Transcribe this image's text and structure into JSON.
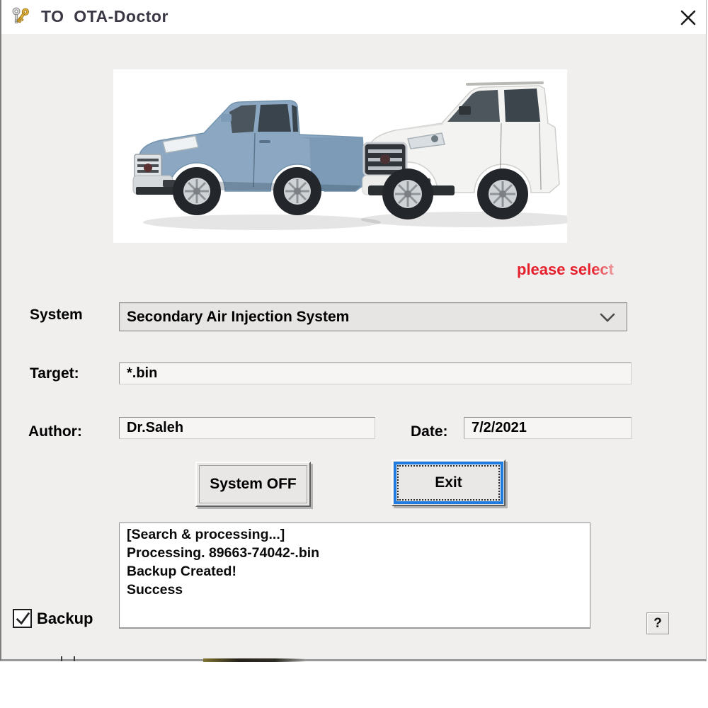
{
  "window": {
    "title": "TO  OTA-Doctor",
    "title_icon": "keys-icon",
    "close_icon": "close-icon"
  },
  "banner": {
    "text": "please select",
    "color": "#e51f2b"
  },
  "image": {
    "description": "blue Toyota Tundra pickup and white Toyota Sequoia SUV on white background"
  },
  "form": {
    "system_label": "System",
    "system_value": "Secondary Air Injection System",
    "system_dropdown_icon": "chevron-down-icon",
    "target_label": "Target:",
    "target_value": "*.bin",
    "author_label": "Author:",
    "author_value": "Dr.Saleh",
    "date_label": "Date:",
    "date_value": "7/2/2021"
  },
  "buttons": {
    "system_off": "System OFF",
    "exit": "Exit",
    "help": "?"
  },
  "log_lines": [
    "[Search & processing...]",
    "Processing. 89663-74042-.bin",
    "Backup Created!",
    "Success"
  ],
  "backup": {
    "label": "Backup",
    "checked": true,
    "check_icon": "checkmark-icon"
  },
  "colors": {
    "body_bg": "#f1efee",
    "focus_blue": "#1e7ce0",
    "accent_red": "#e51f2b",
    "truck_blue": "#8ba7c1"
  }
}
